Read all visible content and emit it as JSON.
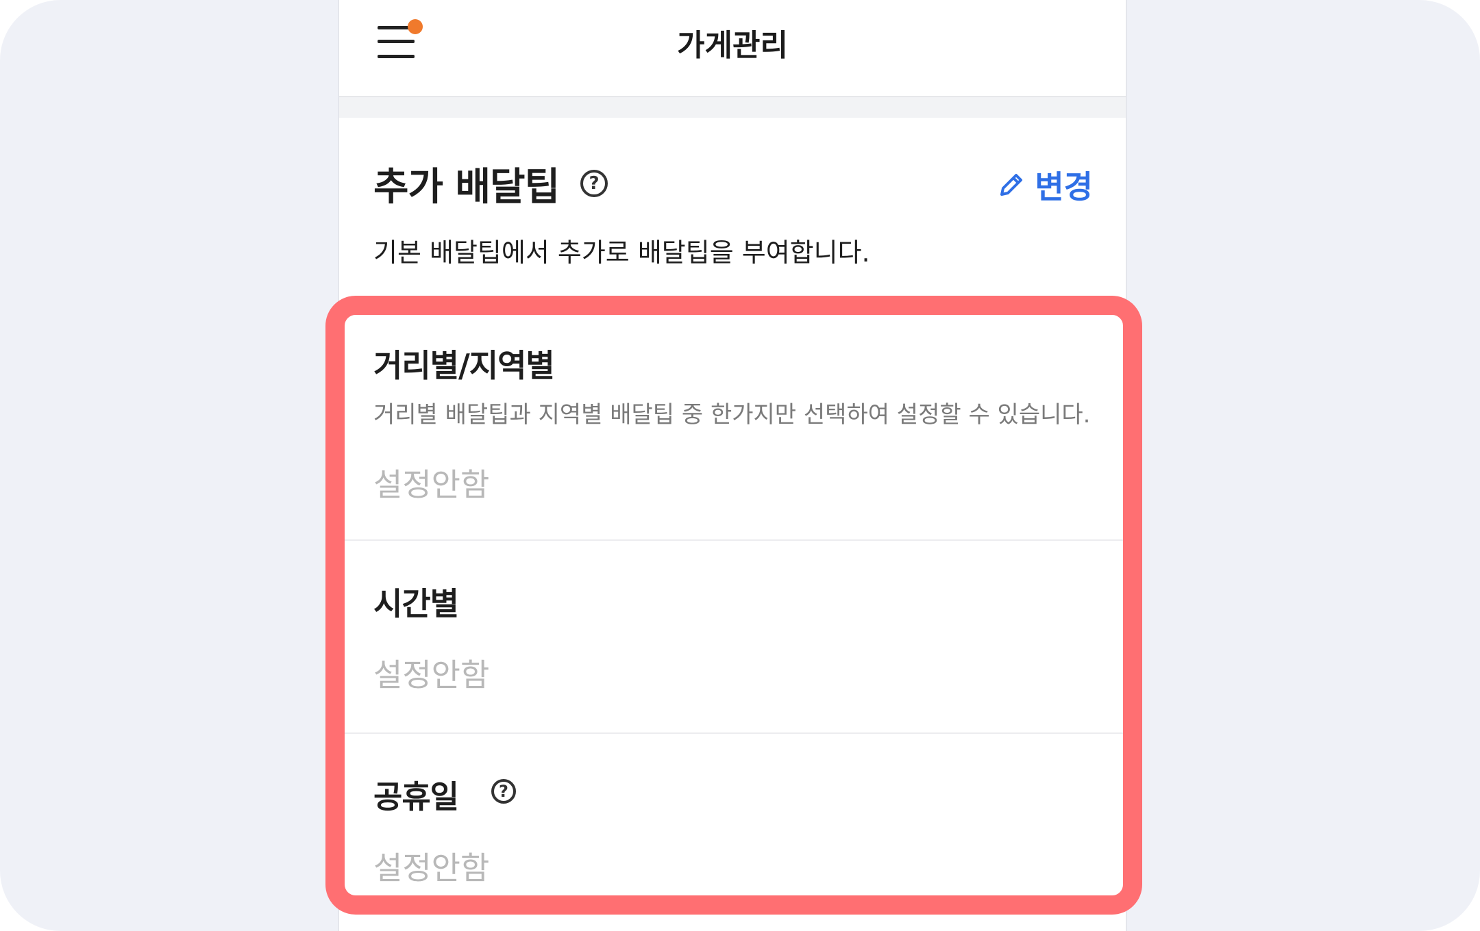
{
  "header": {
    "title": "가게관리",
    "menu_icon": "hamburger-menu-icon",
    "notification_color": "#f07a2c"
  },
  "section": {
    "title": "추가 배달팁",
    "help_icon": "question-circle-icon",
    "edit_label": "변경",
    "edit_icon": "pencil-icon",
    "description": "기본 배달팁에서 추가로 배달팁을 부여합니다."
  },
  "items": [
    {
      "title": "거리별/지역별",
      "description": "거리별 배달팁과 지역별 배달팁 중 한가지만 선택하여 설정할 수 있습니다.",
      "value": "설정안함"
    },
    {
      "title": "시간별",
      "value": "설정안함"
    },
    {
      "title": "공휴일",
      "help_icon": "question-circle-icon",
      "value": "설정안함"
    }
  ],
  "colors": {
    "accent": "#2f6fe6",
    "highlight": "#ff6f72",
    "placeholder": "#b8b8b8"
  }
}
